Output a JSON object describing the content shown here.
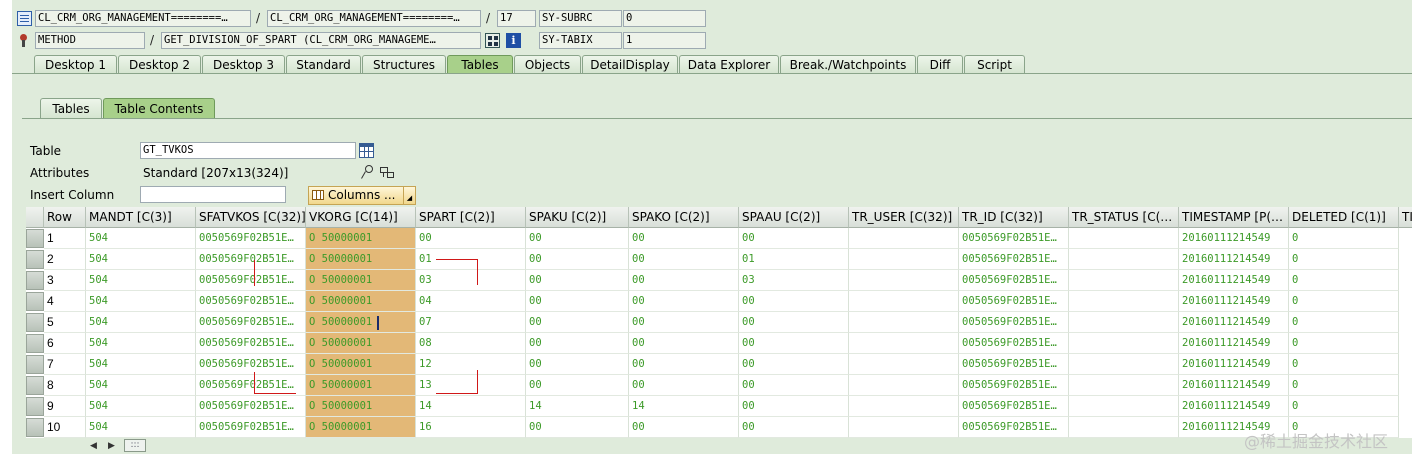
{
  "header": {
    "row1": {
      "program": "CL_CRM_ORG_MANAGEMENT========…",
      "include": "CL_CRM_ORG_MANAGEMENT========…",
      "line": "17",
      "var_name": "SY-SUBRC",
      "var_value": "0"
    },
    "row2": {
      "type": "METHOD",
      "name": "GET_DIVISION_OF_SPART (CL_CRM_ORG_MANAGEME…",
      "var_name": "SY-TABIX",
      "var_value": "1"
    },
    "sep": "/"
  },
  "tabs": [
    "Desktop 1",
    "Desktop 2",
    "Desktop 3",
    "Standard",
    "Structures",
    "Tables",
    "Objects",
    "DetailDisplay",
    "Data Explorer",
    "Break./Watchpoints",
    "Diff",
    "Script"
  ],
  "active_tab": "Tables",
  "subtabs": [
    "Tables",
    "Table Contents"
  ],
  "form": {
    "table_label": "Table",
    "table_value": "GT_TVKOS",
    "attributes_label": "Attributes",
    "attributes_value": "Standard [207x13(324)]",
    "insert_column_label": "Insert Column",
    "insert_column_value": "",
    "columns_button": "Columns ..."
  },
  "grid": {
    "columns": [
      "Row",
      "MANDT [C(3)]",
      "SFATVKOS [C(32)]",
      "VKORG [C(14)]",
      "SPART [C(2)]",
      "SPAKU [C(2)]",
      "SPAKO [C(2)]",
      "SPAAU [C(2)]",
      "TR_USER [C(32)]",
      "TR_ID [C(32)]",
      "TR_STATUS [C(…",
      "TIMESTAMP [P(…",
      "DELETED [C(1)]",
      "TI"
    ],
    "rows": [
      [
        "1",
        "504",
        "0050569F02B51E…",
        "O 50000001",
        "00",
        "00",
        "00",
        "00",
        "",
        "0050569F02B51E…",
        "",
        "20160111214549",
        "0"
      ],
      [
        "2",
        "504",
        "0050569F02B51E…",
        "O 50000001",
        "01",
        "00",
        "00",
        "01",
        "",
        "0050569F02B51E…",
        "",
        "20160111214549",
        "0"
      ],
      [
        "3",
        "504",
        "0050569F02B51E…",
        "O 50000001",
        "03",
        "00",
        "00",
        "03",
        "",
        "0050569F02B51E…",
        "",
        "20160111214549",
        "0"
      ],
      [
        "4",
        "504",
        "0050569F02B51E…",
        "O 50000001",
        "04",
        "00",
        "00",
        "00",
        "",
        "0050569F02B51E…",
        "",
        "20160111214549",
        "0"
      ],
      [
        "5",
        "504",
        "0050569F02B51E…",
        "O 50000001",
        "07",
        "00",
        "00",
        "00",
        "",
        "0050569F02B51E…",
        "",
        "20160111214549",
        "0"
      ],
      [
        "6",
        "504",
        "0050569F02B51E…",
        "O 50000001",
        "08",
        "00",
        "00",
        "00",
        "",
        "0050569F02B51E…",
        "",
        "20160111214549",
        "0"
      ],
      [
        "7",
        "504",
        "0050569F02B51E…",
        "O 50000001",
        "12",
        "00",
        "00",
        "00",
        "",
        "0050569F02B51E…",
        "",
        "20160111214549",
        "0"
      ],
      [
        "8",
        "504",
        "0050569F02B51E…",
        "O 50000001",
        "13",
        "00",
        "00",
        "00",
        "",
        "0050569F02B51E…",
        "",
        "20160111214549",
        "0"
      ],
      [
        "9",
        "504",
        "0050569F02B51E…",
        "O 50000001",
        "14",
        "14",
        "14",
        "00",
        "",
        "0050569F02B51E…",
        "",
        "20160111214549",
        "0"
      ],
      [
        "10",
        "504",
        "0050569F02B51E…",
        "O 50000001",
        "16",
        "00",
        "00",
        "00",
        "",
        "0050569F02B51E…",
        "",
        "20160111214549",
        "0"
      ]
    ]
  },
  "scroll_handle": ":::",
  "watermark": "@稀土掘金技术社区",
  "colors": {
    "background": "#dfebdb",
    "highlight_column": "#e3b877",
    "cell_text": "#3c9a28",
    "annotation": "#d01818"
  },
  "icons": [
    "program-icon",
    "method-icon",
    "variable-fast-display-icon",
    "info-icon",
    "table-select-icon",
    "key-icon",
    "structure-icon",
    "columns-grid-icon",
    "dropdown-arrow-icon",
    "arrow-left-icon",
    "arrow-right-icon"
  ]
}
